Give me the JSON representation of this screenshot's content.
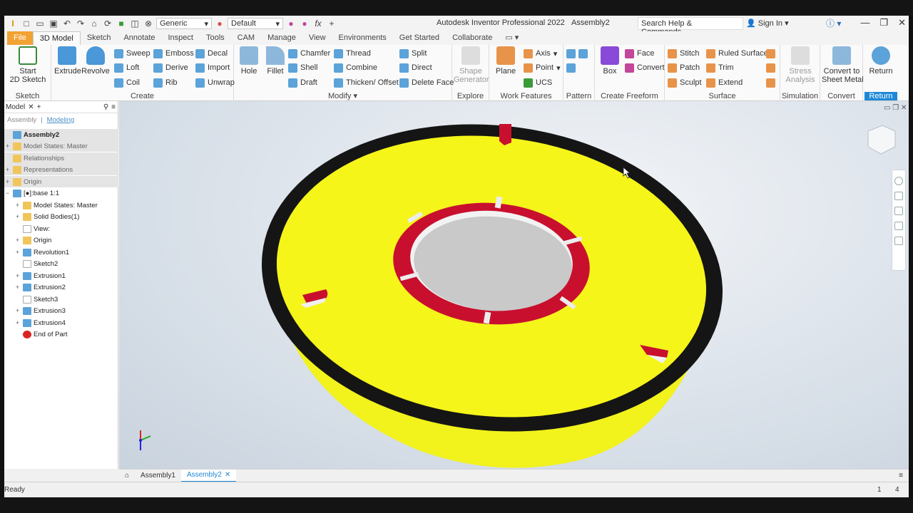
{
  "title": {
    "app": "Autodesk Inventor Professional 2022",
    "doc": "Assembly2",
    "search_placeholder": "Search Help & Commands...",
    "sign_in": "Sign In",
    "appearance": "Generic",
    "material": "Default"
  },
  "tabs": [
    "File",
    "3D Model",
    "Sketch",
    "Annotate",
    "Inspect",
    "Tools",
    "CAM",
    "Manage",
    "View",
    "Environments",
    "Get Started",
    "Collaborate"
  ],
  "ribbon": {
    "sketch": {
      "title": "Sketch",
      "start": "Start",
      "start2": "2D Sketch"
    },
    "create": {
      "title": "Create",
      "extrude": "Extrude",
      "revolve": "Revolve",
      "sweep": "Sweep",
      "loft": "Loft",
      "coil": "Coil",
      "emboss": "Emboss",
      "derive": "Derive",
      "rib": "Rib",
      "decal": "Decal",
      "import": "Import",
      "unwrap": "Unwrap"
    },
    "modify": {
      "title": "Modify",
      "hole": "Hole",
      "fillet": "Fillet",
      "chamfer": "Chamfer",
      "shell": "Shell",
      "draft": "Draft",
      "thread": "Thread",
      "combine": "Combine",
      "thicken": "Thicken/ Offset",
      "split": "Split",
      "direct": "Direct",
      "delete_face": "Delete Face"
    },
    "explore": {
      "title": "Explore",
      "shape": "Shape",
      "generator": "Generator"
    },
    "work": {
      "title": "Work Features",
      "plane": "Plane",
      "axis": "Axis",
      "point": "Point",
      "ucs": "UCS"
    },
    "pattern": {
      "title": "Pattern"
    },
    "freeform": {
      "title": "Create Freeform",
      "box": "Box",
      "face": "Face",
      "convert": "Convert"
    },
    "surface": {
      "title": "Surface",
      "stitch": "Stitch",
      "patch": "Patch",
      "sculpt": "Sculpt",
      "ruled": "Ruled Surface",
      "trim": "Trim",
      "extend": "Extend"
    },
    "simulation": {
      "title": "Simulation",
      "stress": "Stress",
      "analysis": "Analysis"
    },
    "convert": {
      "title": "Convert",
      "c1": "Convert to",
      "c2": "Sheet Metal"
    },
    "return": {
      "title": "Return",
      "label": "Return"
    }
  },
  "browser": {
    "tab": "Model",
    "sub_assembly": "Assembly",
    "sub_modeling": "Modeling",
    "items": [
      {
        "label": "Assembly2",
        "bold": true
      },
      {
        "label": "Model States: Master"
      },
      {
        "label": "Relationships"
      },
      {
        "label": "Representations"
      },
      {
        "label": "Origin"
      },
      {
        "label": "[●]:base 1:1"
      },
      {
        "label": "Model States: Master"
      },
      {
        "label": "Solid Bodies(1)"
      },
      {
        "label": "View:"
      },
      {
        "label": "Origin"
      },
      {
        "label": "Revolution1"
      },
      {
        "label": "Sketch2"
      },
      {
        "label": "Extrusion1"
      },
      {
        "label": "Extrusion2"
      },
      {
        "label": "Sketch3"
      },
      {
        "label": "Extrusion3"
      },
      {
        "label": "Extrusion4"
      },
      {
        "label": "End of Part"
      }
    ]
  },
  "doc_tabs": [
    "Assembly1",
    "Assembly2"
  ],
  "status": {
    "text": "Ready",
    "n1": "1",
    "n2": "4"
  },
  "colors": {
    "accent": "#1e88d8",
    "file_tab": "#f2a233",
    "part_yellow": "#f5f51a",
    "rim_black": "#151515",
    "slot_red": "#c8102e"
  }
}
